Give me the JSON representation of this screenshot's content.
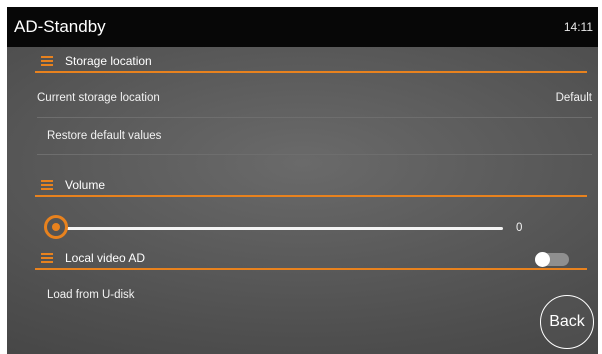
{
  "titlebar": {
    "app_title": "AD-Standby",
    "clock": "14:11"
  },
  "storage": {
    "header": "Storage location",
    "current_label": "Current storage location",
    "current_value": "Default",
    "restore_label": "Restore default values"
  },
  "volume": {
    "header": "Volume",
    "value": "0",
    "level_fraction": 0
  },
  "local_video": {
    "header": "Local video AD",
    "toggle_state": "off",
    "load_label": "Load from U-disk"
  },
  "back_button": {
    "label": "Back"
  },
  "colors": {
    "accent": "#e8821e",
    "titlebar": "#070707"
  },
  "icons": {
    "section_header": "menu-icon"
  }
}
